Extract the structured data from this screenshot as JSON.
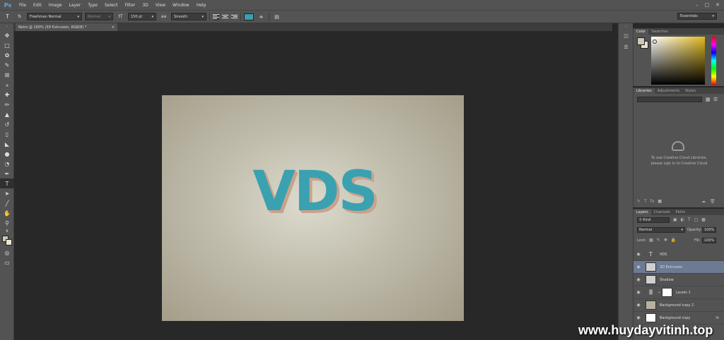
{
  "app": {
    "logo": "Ps"
  },
  "menu": [
    "File",
    "Edit",
    "Image",
    "Layer",
    "Type",
    "Select",
    "Filter",
    "3D",
    "View",
    "Window",
    "Help"
  ],
  "options": {
    "font_family": "Freehman Normal",
    "font_style": "Normal",
    "font_size": "150 pt",
    "anti_alias": "Smooth",
    "text_color": "#3a9fae",
    "workspace": "Essentials"
  },
  "document": {
    "tab_title": "Retro @ 100% (3D Extrusion, RGB/8) *",
    "text": "VDS"
  },
  "panels": {
    "color_tabs": [
      "Color",
      "Swatches"
    ],
    "library_tabs": [
      "Libraries",
      "Adjustments",
      "Styles"
    ],
    "library_msg_1": "To use Creative Cloud Libraries,",
    "library_msg_2": "please sign in to Creative Cloud",
    "layer_tabs": [
      "Layers",
      "Channels",
      "Paths"
    ],
    "kind": "Kind",
    "blend_mode": "Normal",
    "opacity_label": "Opacity:",
    "opacity": "100%",
    "lock_label": "Lock:",
    "fill_label": "Fill:",
    "fill": "100%"
  },
  "layers": [
    {
      "name": "VDS"
    },
    {
      "name": "3D Extrusion"
    },
    {
      "name": "Shadow"
    },
    {
      "name": "Levels 1"
    },
    {
      "name": "Background copy 2"
    },
    {
      "name": "Background copy"
    }
  ],
  "watermark": "www.huydayvitinh.top"
}
